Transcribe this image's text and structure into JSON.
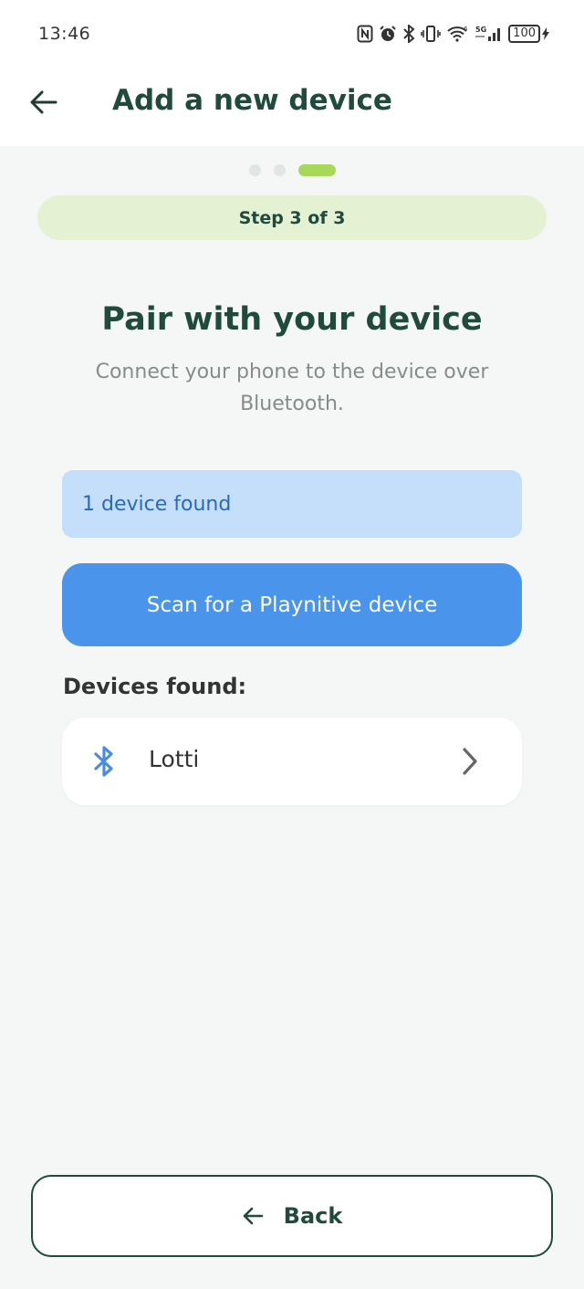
{
  "status_bar": {
    "time": "13:46",
    "battery": "100",
    "icons": [
      "nfc-icon",
      "alarm-icon",
      "bluetooth-icon",
      "vibrate-icon",
      "wifi-icon",
      "signal-icon",
      "battery-icon",
      "charging-icon"
    ]
  },
  "header": {
    "title": "Add a new device",
    "back_icon": "arrow-left-icon"
  },
  "progress": {
    "total_steps": 3,
    "current_step": 3,
    "step_label": "Step 3 of 3"
  },
  "content": {
    "title": "Pair with your device",
    "subtitle": "Connect your phone to the device over Bluetooth.",
    "found_banner": "1 device found",
    "scan_button": "Scan for a Playnitive device",
    "devices_label": "Devices found:",
    "devices": [
      {
        "name": "Lotti",
        "icon": "bluetooth-icon"
      }
    ]
  },
  "footer": {
    "back_label": "Back"
  },
  "colors": {
    "primary_dark": "#1f4a3c",
    "accent_green": "#a8d85a",
    "scan_blue": "#4a94ec",
    "banner_blue": "#c5dffa",
    "background": "#f4f7f6"
  }
}
